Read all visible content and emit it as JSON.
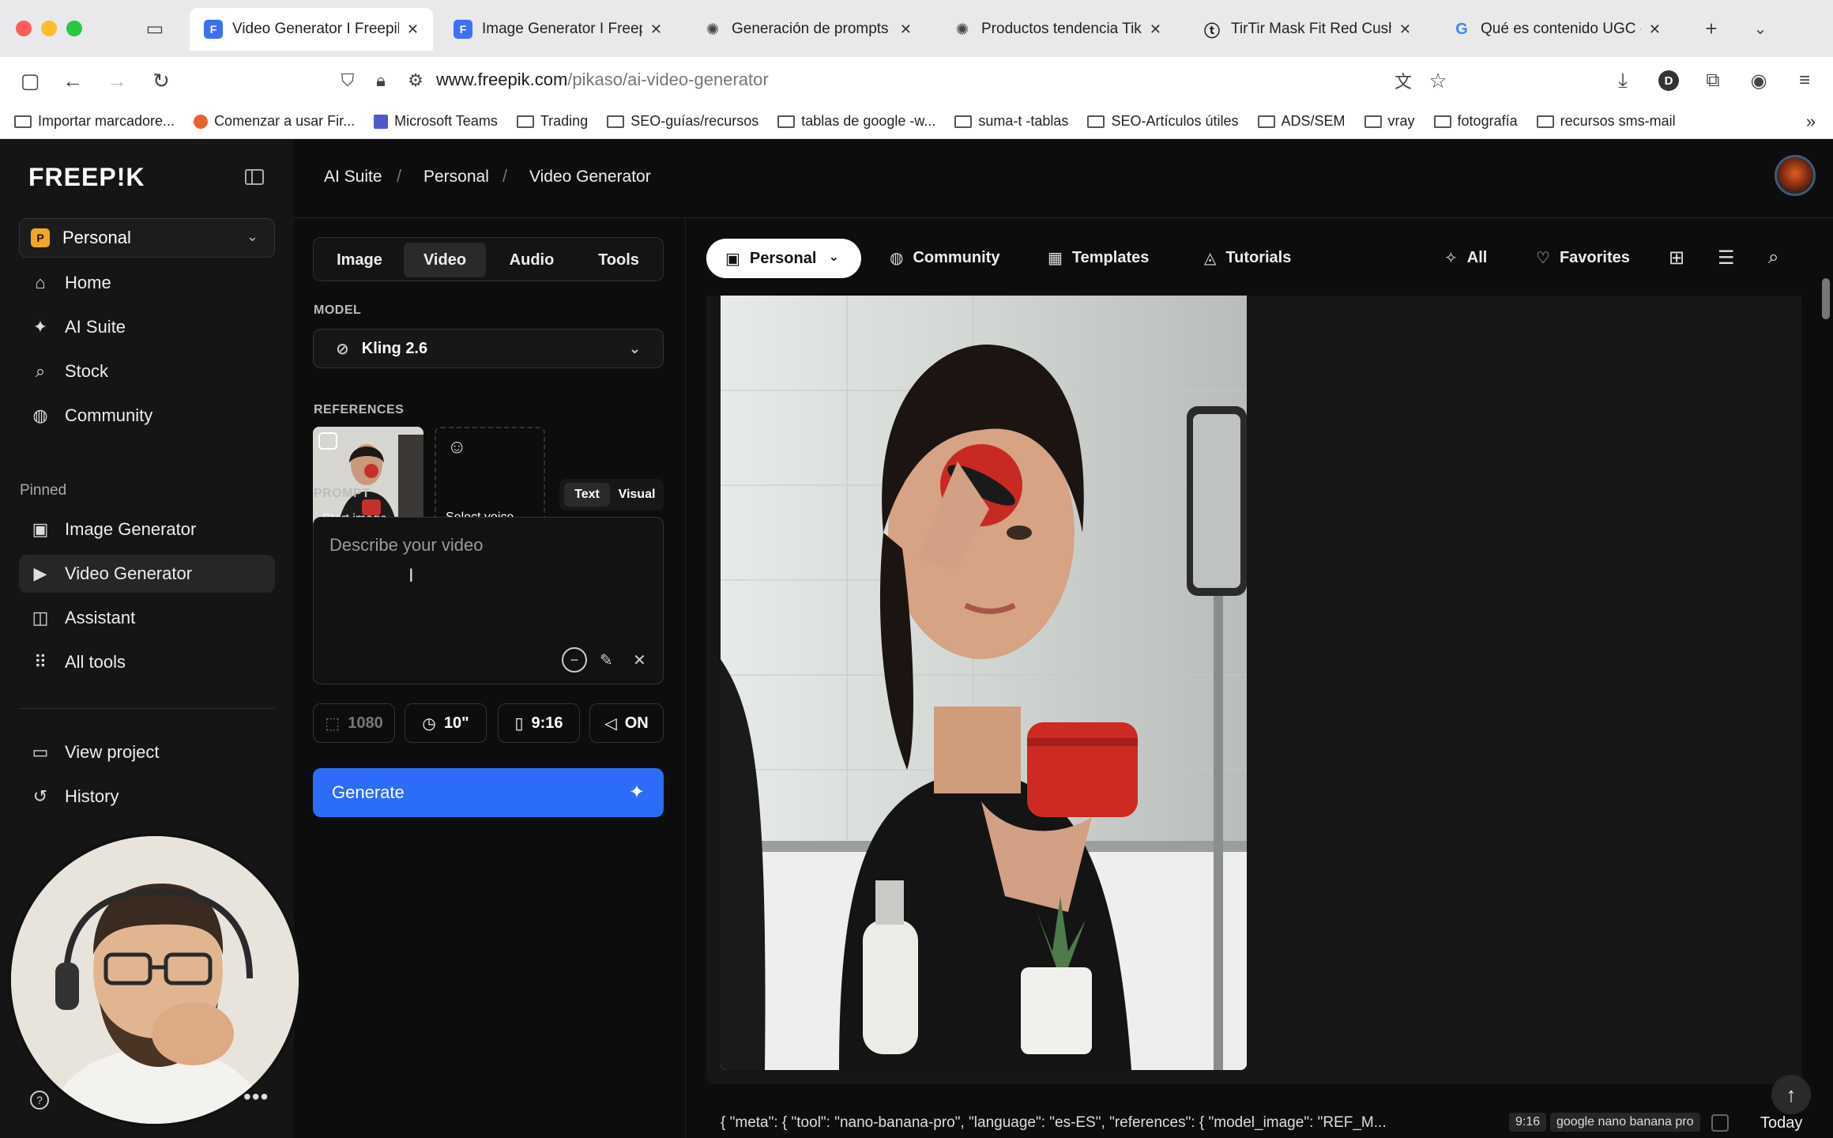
{
  "browser": {
    "tabs": [
      {
        "title": "Video Generator I Freepik AI",
        "favicon": "F",
        "color": "#3f6ff5",
        "active": true
      },
      {
        "title": "Image Generator I Freepik AI",
        "favicon": "F",
        "color": "#3f6ff5",
        "active": false
      },
      {
        "title": "Generación de prompts JSON",
        "favicon": "✺",
        "color": "#444444",
        "active": false
      },
      {
        "title": "Productos tendencia TikTok",
        "favicon": "✺",
        "color": "#444444",
        "active": false
      },
      {
        "title": "TirTir Mask Fit Red Cushion",
        "favicon": "ⓣ",
        "color": "#111111",
        "active": false
      },
      {
        "title": "Qué es contenido UGC - Buscar",
        "favicon": "G",
        "color": "#4285f4",
        "active": false
      }
    ],
    "new_tab_icon": "plus-icon",
    "url_domain": "www.freepik.com",
    "url_path": "/pikaso/ai-video-generator",
    "bookmarks": [
      "Importar marcadore...",
      "Comenzar a usar Fir...",
      "Microsoft Teams",
      "Trading",
      "SEO-guías/recursos",
      "tablas de google -w...",
      "suma-t -tablas",
      "SEO-Artículos útiles",
      "ADS/SEM",
      "vray",
      "fotografía",
      "recursos sms-mail"
    ]
  },
  "sidebar": {
    "logo": "FREEP!K",
    "workspace": {
      "badge": "P",
      "name": "Personal"
    },
    "items": [
      {
        "label": "Home",
        "icon": "home-icon",
        "glyph": "⌂"
      },
      {
        "label": "AI Suite",
        "icon": "sparkle-icon",
        "glyph": "✦"
      },
      {
        "label": "Stock",
        "icon": "search-icon",
        "glyph": "⌕"
      },
      {
        "label": "Community",
        "icon": "globe-icon",
        "glyph": "◍"
      }
    ],
    "pinned_label": "Pinned",
    "pinned": [
      {
        "label": "Image Generator",
        "icon": "image-icon",
        "glyph": "▣"
      },
      {
        "label": "Video Generator",
        "icon": "video-icon",
        "glyph": "▶"
      },
      {
        "label": "Assistant",
        "icon": "assistant-icon",
        "glyph": "◫"
      },
      {
        "label": "All tools",
        "icon": "grid-icon",
        "glyph": "⠿"
      }
    ],
    "bottom": [
      {
        "label": "View project",
        "icon": "project-icon",
        "glyph": "▭"
      },
      {
        "label": "History",
        "icon": "history-icon",
        "glyph": "↺"
      }
    ]
  },
  "breadcrumb": [
    "AI Suite",
    "Personal",
    "Video Generator"
  ],
  "panel": {
    "modes": [
      "Image",
      "Video",
      "Audio",
      "Tools"
    ],
    "active_mode": "Video",
    "model_label": "MODEL",
    "model_value": "Kling 2.6",
    "references_label": "REFERENCES",
    "start_image_label": "Start image",
    "select_voice_label": "Select voice",
    "prompt_label": "PROMPT",
    "prompt_modes": [
      "Text",
      "Visual"
    ],
    "prompt_placeholder": "Describe your video",
    "settings": [
      {
        "value": "1080",
        "icon": "resolution-icon",
        "glyph": "⬚",
        "dim": true
      },
      {
        "value": "10\"",
        "icon": "clock-icon",
        "glyph": "◷",
        "dim": false
      },
      {
        "value": "9:16",
        "icon": "aspect-ratio-icon",
        "glyph": "▯",
        "dim": false
      },
      {
        "value": "ON",
        "icon": "speaker-icon",
        "glyph": "◁",
        "dim": false
      }
    ],
    "generate_label": "Generate"
  },
  "main": {
    "filter_pill": "Personal",
    "tabs": [
      {
        "label": "Community",
        "icon": "globe-icon",
        "glyph": "◍"
      },
      {
        "label": "Templates",
        "icon": "templates-icon",
        "glyph": "▦"
      },
      {
        "label": "Tutorials",
        "icon": "tutorials-icon",
        "glyph": "◬"
      }
    ],
    "all_label": "All",
    "favorites_label": "Favorites",
    "prompt_row": "{ \"meta\": { \"tool\": \"nano-banana-pro\", \"language\": \"es-ES\", \"references\": { \"model_image\": \"REF_M...",
    "ratio_tag": "9:16",
    "model_tag": "google nano banana pro",
    "date_label": "Today"
  }
}
